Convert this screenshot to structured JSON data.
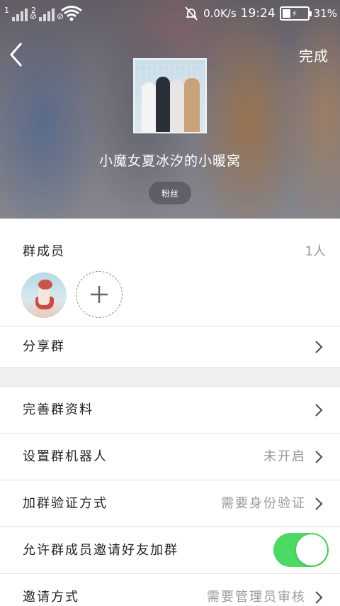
{
  "status_bar": {
    "sim1": "1",
    "sim2": "2",
    "net_speed": "0.0K/s",
    "time": "19:24",
    "battery_percent": "31%",
    "battery_level": 0.31
  },
  "header": {
    "back_icon": "back-arrow-icon",
    "done_label": "完成",
    "group_name": "小魔女夏冰汐的小暖窝",
    "tag_label": "粉丝"
  },
  "members": {
    "title": "群成员",
    "count": "1人",
    "add_icon": "plus-icon"
  },
  "rows": {
    "share_group": "分享群",
    "complete_profile": "完善群资料",
    "group_robot": {
      "label": "设置群机器人",
      "value": "未开启"
    },
    "join_verification": {
      "label": "加群验证方式",
      "value": "需要身份验证"
    },
    "allow_invite": {
      "label": "允许群成员邀请好友加群",
      "enabled": true
    },
    "invite_method": {
      "label": "邀请方式",
      "value": "需要管理员审核"
    }
  },
  "colors": {
    "toggle_on": "#4cd964",
    "secondary_text": "#999999"
  }
}
